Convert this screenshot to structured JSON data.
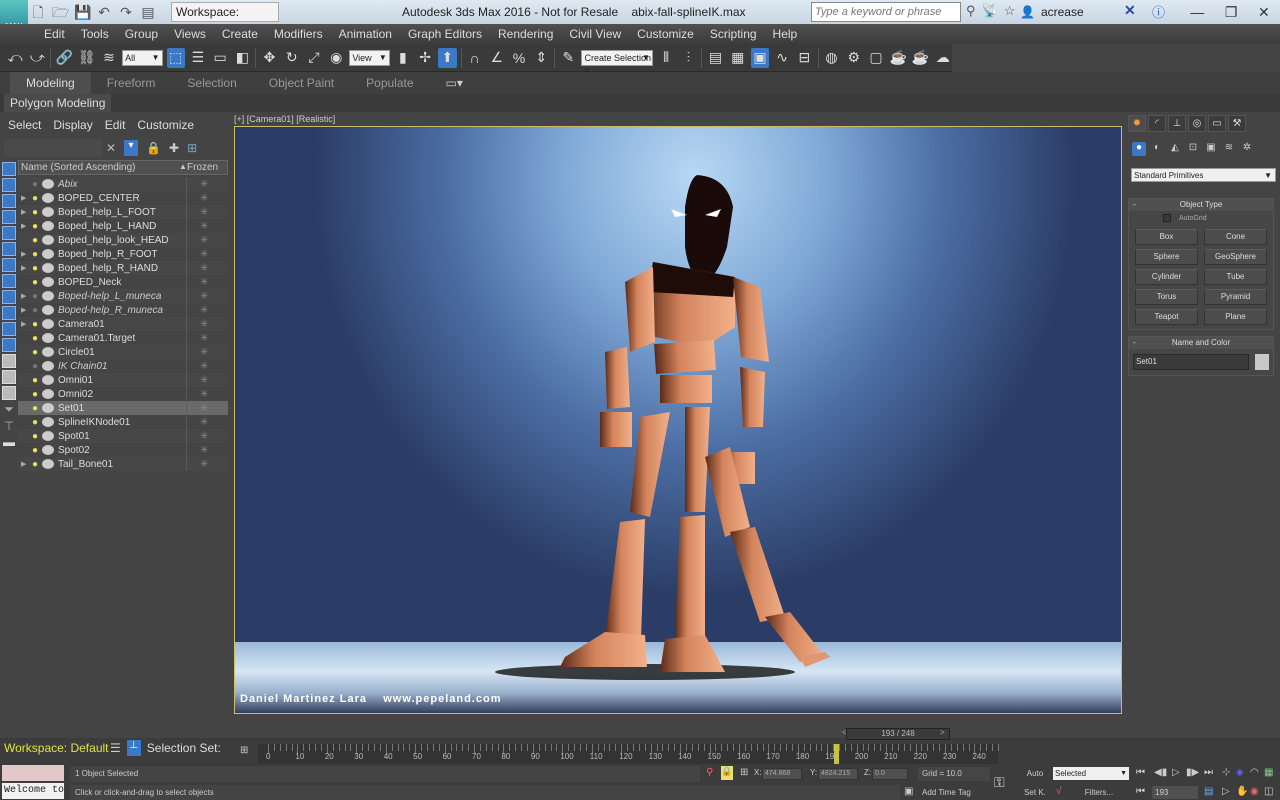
{
  "titlebar": {
    "app_button_label": "MAX",
    "workspace": "Workspace: Default",
    "title": "Autodesk 3ds Max 2016 - Not for Resale    abix-fall-splineIK.max",
    "search_placeholder": "Type a keyword or phrase",
    "user": "acrease"
  },
  "menubar": [
    "Edit",
    "Tools",
    "Group",
    "Views",
    "Create",
    "Modifiers",
    "Animation",
    "Graph Editors",
    "Rendering",
    "Civil View",
    "Customize",
    "Scripting",
    "Help"
  ],
  "toolbar": {
    "selection_filter": "All",
    "ref_coord": "View",
    "named_selection": "Create Selection S"
  },
  "ribbon": {
    "tabs": [
      "Modeling",
      "Freeform",
      "Selection",
      "Object Paint",
      "Populate"
    ],
    "active_tab": "Modeling",
    "panel": "Polygon Modeling"
  },
  "explorer": {
    "menu": [
      "Select",
      "Display",
      "Edit",
      "Customize"
    ],
    "col_name": "Name (Sorted Ascending)",
    "col_frozen": "Frozen",
    "rows": [
      {
        "name": "Abix",
        "italic": true,
        "expand": false,
        "light": false
      },
      {
        "name": "BOPED_CENTER",
        "italic": false,
        "expand": true,
        "light": true
      },
      {
        "name": "Boped_help_L_FOOT",
        "italic": false,
        "expand": true,
        "light": true
      },
      {
        "name": "Boped_help_L_HAND",
        "italic": false,
        "expand": true,
        "light": true
      },
      {
        "name": "Boped_help_look_HEAD",
        "italic": false,
        "expand": false,
        "light": true
      },
      {
        "name": "Boped_help_R_FOOT",
        "italic": false,
        "expand": true,
        "light": true
      },
      {
        "name": "Boped_help_R_HAND",
        "italic": false,
        "expand": true,
        "light": true
      },
      {
        "name": "BOPED_Neck",
        "italic": false,
        "expand": false,
        "light": true
      },
      {
        "name": "Boped-help_L_muneca",
        "italic": true,
        "expand": true,
        "light": false
      },
      {
        "name": "Boped-help_R_muneca",
        "italic": true,
        "expand": true,
        "light": false
      },
      {
        "name": "Camera01",
        "italic": false,
        "expand": true,
        "light": true
      },
      {
        "name": "Camera01.Target",
        "italic": false,
        "expand": false,
        "light": true
      },
      {
        "name": "Circle01",
        "italic": false,
        "expand": false,
        "light": true
      },
      {
        "name": "IK Chain01",
        "italic": true,
        "expand": false,
        "light": false
      },
      {
        "name": "Omni01",
        "italic": false,
        "expand": false,
        "light": true
      },
      {
        "name": "Omni02",
        "italic": false,
        "expand": false,
        "light": true
      },
      {
        "name": "Set01",
        "italic": false,
        "expand": false,
        "light": true,
        "selected": true
      },
      {
        "name": "SplineIKNode01",
        "italic": false,
        "expand": false,
        "light": true
      },
      {
        "name": "Spot01",
        "italic": false,
        "expand": false,
        "light": true
      },
      {
        "name": "Spot02",
        "italic": false,
        "expand": false,
        "light": true
      },
      {
        "name": "Tail_Bone01",
        "italic": false,
        "expand": true,
        "light": true
      }
    ]
  },
  "viewport": {
    "label": "[+] [Camera01] [Realistic]",
    "credit": "Daniel Martinez Lara    www.pepeland.com"
  },
  "command_panel": {
    "category": "Standard Primitives",
    "object_type_title": "Object Type",
    "autogrid": "AutoGrid",
    "buttons": [
      "Box",
      "Cone",
      "Sphere",
      "GeoSphere",
      "Cylinder",
      "Tube",
      "Torus",
      "Pyramid",
      "Teapot",
      "Plane"
    ],
    "name_color_title": "Name and Color",
    "object_name": "Set01"
  },
  "timeline": {
    "current_frame": 193,
    "total_frames": 248,
    "slider_label": "193 / 248",
    "ticks": [
      0,
      10,
      20,
      30,
      40,
      50,
      60,
      70,
      80,
      90,
      100,
      110,
      120,
      130,
      140,
      150,
      160,
      170,
      180,
      190,
      200,
      210,
      220,
      230,
      240
    ]
  },
  "status": {
    "workspace": "Workspace: Default",
    "selection_set": "Selection Set:",
    "welcome": "Welcome to",
    "selected_count": "1 Object Selected",
    "prompt": "Click or click-and-drag to select objects",
    "x": "474.868",
    "y": "4824.215",
    "z": "0.0",
    "x_label": "X:",
    "y_label": "Y:",
    "z_label": "Z:",
    "grid": "Grid = 10.0",
    "add_time_tag": "Add Time Tag",
    "auto_key": "Auto",
    "set_key": "Set K.",
    "key_mode": "Selected",
    "filters": "Filters...",
    "frame": "193"
  }
}
